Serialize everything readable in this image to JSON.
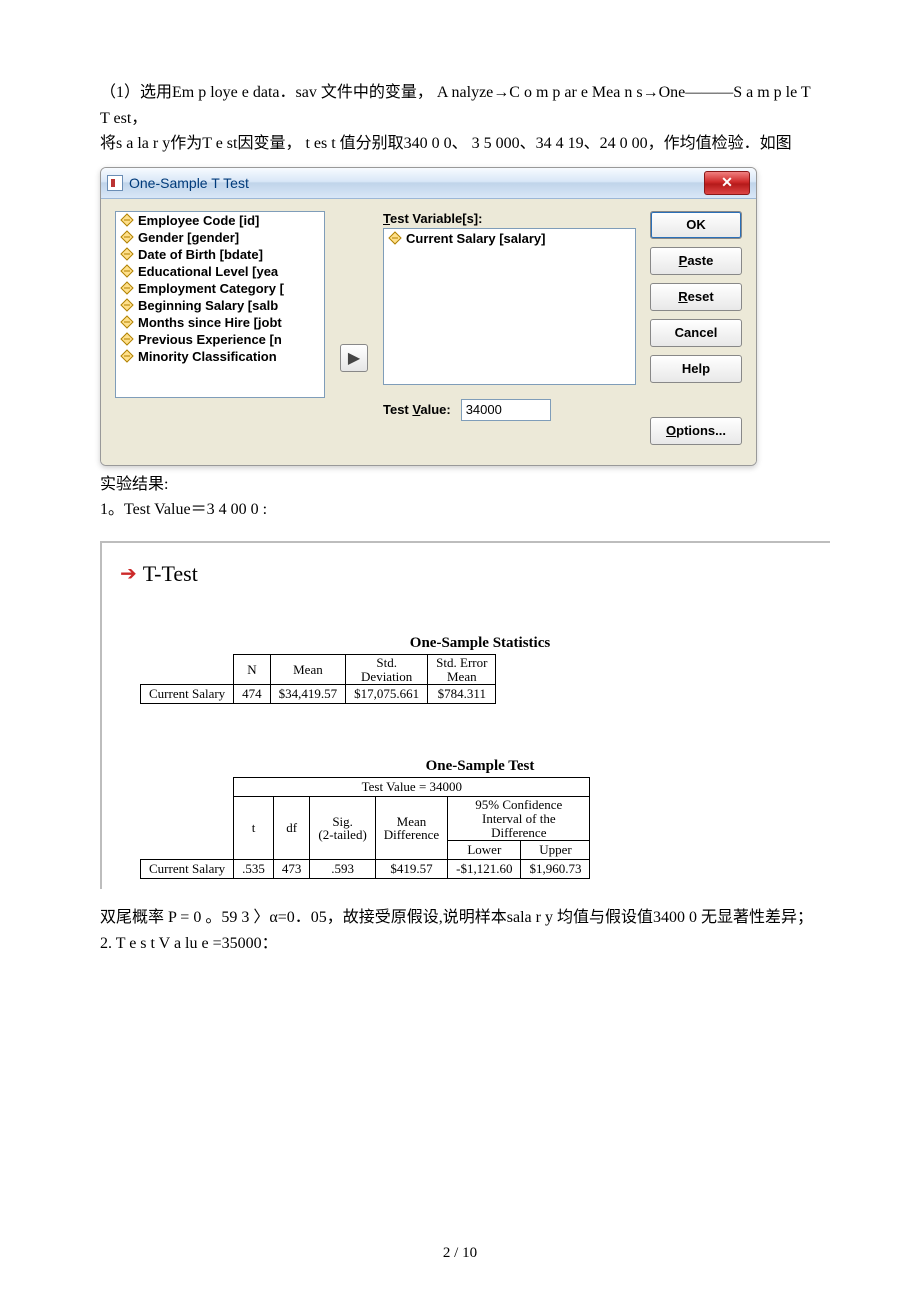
{
  "text": {
    "p1": "（1）选用Em p loye e   data．sav 文件中的变量， A nalyze→C o m p ar e   Mea n s→One―――S a m p le T T est，",
    "p2": "将s a la r y作为T e st因变量，  t es t 值分别取340 0 0、 3 5 000、34 4 19、24 0 00，作均值检验．如图",
    "p3": "实验结果:",
    "p4": "1。Test   Value＝3 4 00 0 :",
    "p5": "双尾概率 P = 0 。59 3 〉α=0．05，故接受原假设,说明样本sala r y 均值与假设值3400 0 无显著性差异；",
    "p6": "2. T e s   t   V  a lu e =35000："
  },
  "dialog": {
    "title": "One-Sample T Test",
    "close": "✕",
    "vars": [
      "Employee Code [id]",
      "Gender [gender]",
      "Date of Birth [bdate]",
      "Educational Level [yea",
      "Employment Category [",
      "Beginning Salary [salb",
      "Months since Hire [jobt",
      "Previous Experience [n",
      "Minority Classification"
    ],
    "test_vars_label": [
      "T",
      "est Variable[s]:"
    ],
    "test_var_item": "Current Salary [salary]",
    "test_value_label": [
      "Test ",
      "V",
      "alue:"
    ],
    "test_value": "34000",
    "buttons": {
      "ok": "OK",
      "paste": [
        "P",
        "aste"
      ],
      "reset": [
        "R",
        "eset"
      ],
      "cancel": "Cancel",
      "help": "Help",
      "options": [
        "O",
        "ptions..."
      ]
    }
  },
  "output": {
    "head": "T-Test",
    "stats": {
      "title": "One-Sample Statistics",
      "headers": [
        "",
        "N",
        "Mean",
        "Std. Deviation",
        "Std. Error Mean"
      ],
      "row_label": "Current Salary",
      "values": [
        "474",
        "$34,419.57",
        "$17,075.661",
        "$784.311"
      ]
    },
    "test": {
      "title": "One-Sample Test",
      "super_header": "Test Value = 34000",
      "ci_header": "95% Confidence Interval of the Difference",
      "cols": [
        "t",
        "df",
        "Sig. (2-tailed)",
        "Mean Difference",
        "Lower",
        "Upper"
      ],
      "row_label": "Current Salary",
      "values": [
        ".535",
        "473",
        ".593",
        "$419.57",
        "-$1,121.60",
        "$1,960.73"
      ]
    }
  },
  "footer": "2 / 10"
}
